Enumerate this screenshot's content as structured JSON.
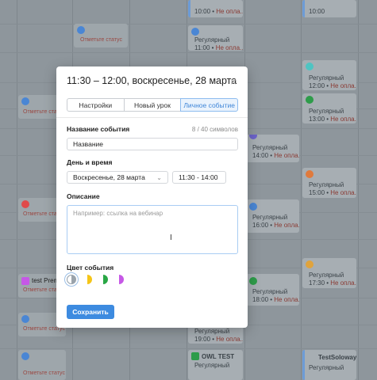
{
  "background": {
    "cards": [
      {
        "title": "10:00 •",
        "status": "Не опла...",
        "color": "#6c9bd6"
      },
      {
        "title": "10:00",
        "status": "",
        "color": "#6c9bd6"
      },
      {
        "title": "Регулярный",
        "time": "11:00 •",
        "status": "Не опла...",
        "color": "#6c9bd6"
      },
      {
        "title": "Регулярный",
        "time": "12:00 •",
        "status": "Не опла...",
        "color": "#4fc4c2"
      },
      {
        "title": "Регулярный",
        "time": "13:00 •",
        "status": "Не опла...",
        "color": "#6ab56e"
      },
      {
        "title": "Регулярный",
        "time": "14:00 •",
        "status": "Не опла...",
        "color": "#6c63c9"
      },
      {
        "title": "Регулярный",
        "time": "15:00 •",
        "status": "Не опла...",
        "color": "#e07a3c"
      },
      {
        "title": "Регулярный",
        "time": "16:00 •",
        "status": "Не опла...",
        "color": "#6c9bd6"
      },
      {
        "title": "Регулярный",
        "time": "17:30 •",
        "status": "Не опла...",
        "color": "#e0a33c"
      },
      {
        "title": "Регулярный",
        "time": "18:00 •",
        "status": "Не опла...",
        "color": "#6ab56e"
      },
      {
        "title": "Регулярный",
        "time": "19:00 •",
        "status": "Не опла...",
        "color": "#6c9bd6"
      },
      {
        "title": "OWL TEST",
        "time": "Регулярный",
        "status": "",
        "color": "#6ab56e"
      },
      {
        "title": "TestSoloway",
        "time": "Регулярный",
        "status": "",
        "color": "#6c9bd6"
      }
    ],
    "status_labels": [
      "Отметьте статус",
      "Отметьте ста",
      "Отметьте ста",
      "Отметьте ста",
      "Отметьте статус",
      "Отметьте статус"
    ],
    "left_names": [
      "test Prem"
    ]
  },
  "modal": {
    "title": "11:30 – 12:00, воскресенье, 28 марта",
    "close_glyph": "×",
    "tabs": [
      {
        "label": "Настройки",
        "active": false
      },
      {
        "label": "Новый урок",
        "active": false
      },
      {
        "label": "Личное событие",
        "active": true
      }
    ],
    "event_name": {
      "label": "Название события",
      "counter": "8 / 40 символов",
      "value": "Название"
    },
    "datetime": {
      "label": "День и время",
      "date": "Воскресенье, 28 марта",
      "time": "11:30 - 14:00"
    },
    "description": {
      "label": "Описание",
      "placeholder": "Например: ссылка на вебинар"
    },
    "color": {
      "label": "Цвет события",
      "swatches": [
        {
          "name": "grey",
          "color": "#9aa3ab",
          "selected": true
        },
        {
          "name": "yellow",
          "color": "#f5c518",
          "selected": false
        },
        {
          "name": "green",
          "color": "#29a745",
          "selected": false
        },
        {
          "name": "purple",
          "color": "#c658e6",
          "selected": false
        }
      ]
    },
    "save_label": "Сохранить"
  }
}
